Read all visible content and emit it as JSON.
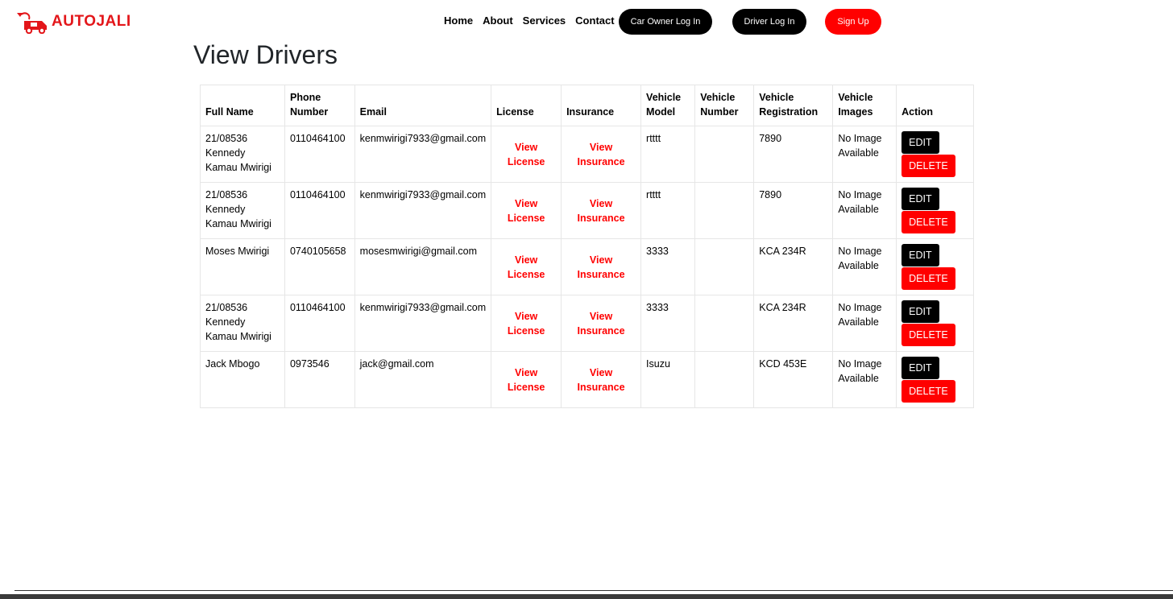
{
  "header": {
    "logo_text": "AUTOJALI",
    "nav": [
      "Home",
      "About",
      "Services",
      "Contact"
    ],
    "car_owner_login": "Car Owner Log In",
    "driver_login": "Driver Log In",
    "sign_up": "Sign Up"
  },
  "page_title": "View Drivers",
  "table": {
    "headers": [
      "Full Name",
      "Phone Number",
      "Email",
      "License",
      "Insurance",
      "Vehicle Model",
      "Vehicle Number",
      "Vehicle Registration",
      "Vehicle Images",
      "Action"
    ],
    "view_license": "View License",
    "view_insurance": "View Insurance",
    "edit_label": "EDIT",
    "delete_label": "DELETE",
    "rows": [
      {
        "full_name": "21/08536 Kennedy Kamau Mwirigi",
        "phone": "0110464100",
        "email": "kenmwirigi7933@gmail.com",
        "vehicle_model": "rtttt",
        "vehicle_number": "",
        "vehicle_registration": "7890",
        "vehicle_images": "No Image Available"
      },
      {
        "full_name": "21/08536 Kennedy Kamau Mwirigi",
        "phone": "0110464100",
        "email": "kenmwirigi7933@gmail.com",
        "vehicle_model": "rtttt",
        "vehicle_number": "",
        "vehicle_registration": "7890",
        "vehicle_images": "No Image Available"
      },
      {
        "full_name": "Moses Mwirigi",
        "phone": "0740105658",
        "email": "mosesmwirigi@gmail.com",
        "vehicle_model": "3333",
        "vehicle_number": "",
        "vehicle_registration": "KCA 234R",
        "vehicle_images": "No Image Available"
      },
      {
        "full_name": "21/08536 Kennedy Kamau Mwirigi",
        "phone": "0110464100",
        "email": "kenmwirigi7933@gmail.com",
        "vehicle_model": "3333",
        "vehicle_number": "",
        "vehicle_registration": "KCA 234R",
        "vehicle_images": "No Image Available"
      },
      {
        "full_name": "Jack Mbogo",
        "phone": "0973546",
        "email": "jack@gmail.com",
        "vehicle_model": "Isuzu",
        "vehicle_number": "",
        "vehicle_registration": "KCD 453E",
        "vehicle_images": "No Image Available"
      }
    ]
  },
  "colors": {
    "brand_red": "#e3161a",
    "link_red": "#ff0000",
    "black": "#000000"
  }
}
